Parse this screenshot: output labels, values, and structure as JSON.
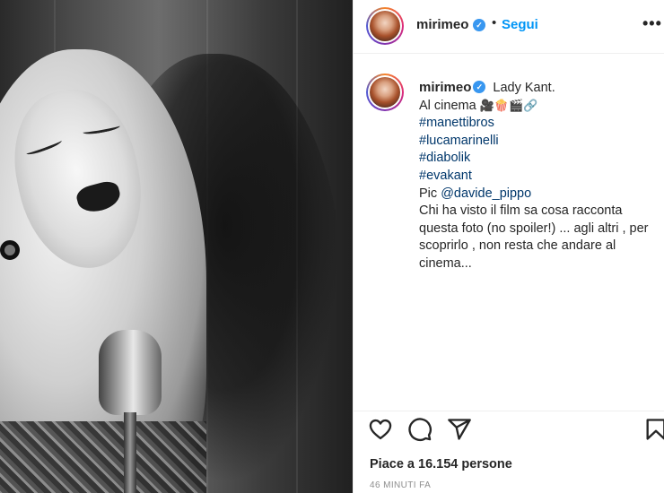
{
  "post": {
    "username": "mirimeo",
    "verified_mark": "✓",
    "dot": "•",
    "follow_label": "Segui",
    "more_label": "•••"
  },
  "caption": {
    "username": "mirimeo",
    "line1": "Lady Kant.",
    "line2_text": "Al cinema",
    "line2_emojis": [
      "film-projector-emoji",
      "popcorn-emoji",
      "clapper-board-emoji",
      "link-emoji"
    ],
    "hashtags": [
      "#manettibros",
      "#lucamarinelli",
      "#diabolik",
      "#evakant"
    ],
    "pic_label": "Pic",
    "mention": "@davide_pippo",
    "body_lines": [
      "Chi ha visto il film sa cosa racconta",
      "questa foto (no spoiler!) ... agli altri , per",
      "scoprirlo , non resta che andare al",
      "cinema..."
    ]
  },
  "actions": {
    "icons": [
      "heart-icon",
      "comment-icon",
      "share-icon",
      "bookmark-icon"
    ]
  },
  "likes_text": "Piace a 16.154 persone",
  "timestamp": "46 MINUTI FA",
  "colors": {
    "accent": "#0095f6",
    "hashtag": "#00376b",
    "verified": "#3897f0",
    "text": "#262626",
    "muted": "#8e8e8e"
  }
}
